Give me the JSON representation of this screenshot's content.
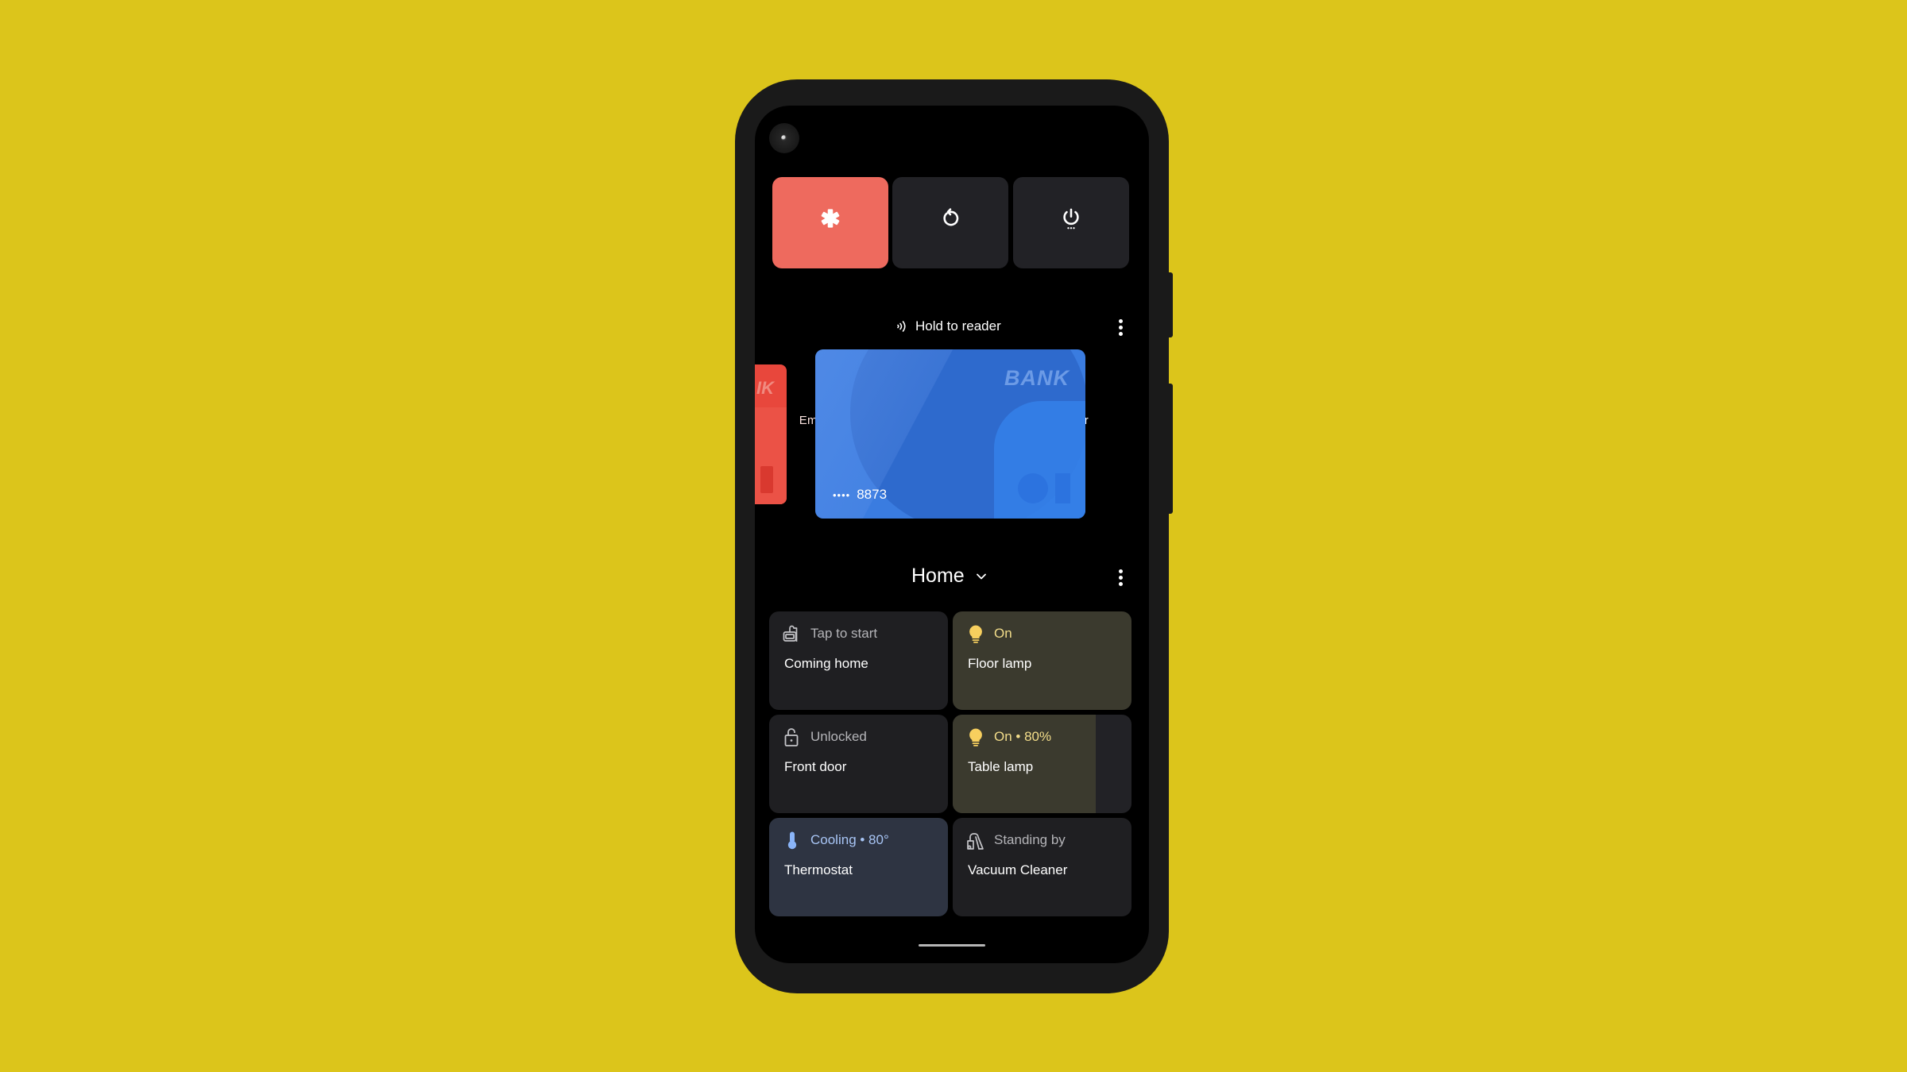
{
  "colors": {
    "background": "#dcc51b",
    "emergency": "#ee6a5e",
    "card_blue": "#3a7ce0",
    "card_red": "#e8473c",
    "lamp_on": "#f7cf5e",
    "thermostat_accent": "#8ab4f8"
  },
  "quick_actions": [
    {
      "label": "Emergency",
      "icon": "medical-asterisk-icon"
    },
    {
      "label": "Restart",
      "icon": "restart-icon"
    },
    {
      "label": "Power",
      "icon": "power-icon"
    }
  ],
  "wallet": {
    "header": "Hold to reader",
    "header_icon": "nfc-icon",
    "active_card": {
      "bank_name": "BANK",
      "masked_dots": "••••",
      "last_four": "8873"
    },
    "peek_card": {
      "bank_name_fragment": "IK"
    }
  },
  "home": {
    "title": "Home",
    "tiles": [
      {
        "status": "Tap to start",
        "name": "Coming home",
        "icon": "routine-icon",
        "type": "routine"
      },
      {
        "status": "On",
        "name": "Floor lamp",
        "icon": "lightbulb-icon",
        "type": "light",
        "brightness": 1.0
      },
      {
        "status": "Unlocked",
        "name": "Front door",
        "icon": "lock-open-icon",
        "type": "lock"
      },
      {
        "status": "On • 80%",
        "name": "Table lamp",
        "icon": "lightbulb-icon",
        "type": "light",
        "brightness": 0.8
      },
      {
        "status": "Cooling • 80°",
        "name": "Thermostat",
        "icon": "thermometer-icon",
        "type": "thermostat"
      },
      {
        "status": "Standing by",
        "name": "Vacuum Cleaner",
        "icon": "vacuum-icon",
        "type": "vacuum"
      }
    ]
  }
}
